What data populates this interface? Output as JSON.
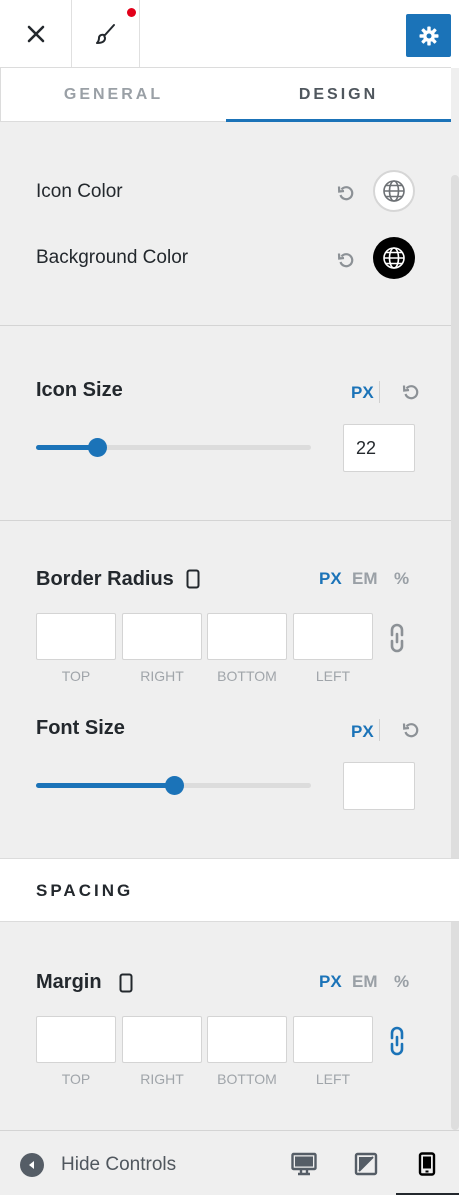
{
  "topbar": {
    "close_icon": "close-icon",
    "brush_icon": "paintbrush-icon",
    "settings_icon": "gear-icon"
  },
  "tabs": [
    {
      "label": "GENERAL",
      "active": false
    },
    {
      "label": "DESIGN",
      "active": true
    }
  ],
  "colors": {
    "accent": "#1b73b8",
    "notification": "#e2001a",
    "icon_color_swatch": "#ffffff",
    "background_color_swatch": "#000000"
  },
  "color_controls": {
    "icon_color_label": "Icon Color",
    "background_color_label": "Background Color"
  },
  "icon_size": {
    "label": "Icon Size",
    "unit": "PX",
    "value": "22",
    "slider_fraction": 0.22
  },
  "border_radius": {
    "label": "Border Radius",
    "units": [
      "PX",
      "EM",
      "%"
    ],
    "active_unit": "PX",
    "fields": [
      "TOP",
      "RIGHT",
      "BOTTOM",
      "LEFT"
    ],
    "linked": false
  },
  "font_size": {
    "label": "Font Size",
    "unit": "PX",
    "value": "",
    "slider_fraction": 0.5
  },
  "spacing": {
    "heading": "SPACING"
  },
  "margin": {
    "label": "Margin",
    "units": [
      "PX",
      "EM",
      "%"
    ],
    "active_unit": "PX",
    "fields": [
      "TOP",
      "RIGHT",
      "BOTTOM",
      "LEFT"
    ],
    "linked": true
  },
  "footer": {
    "hide_controls_label": "Hide Controls",
    "devices": [
      "desktop-icon",
      "tablet-icon",
      "mobile-icon"
    ],
    "active_device": "mobile-icon"
  }
}
